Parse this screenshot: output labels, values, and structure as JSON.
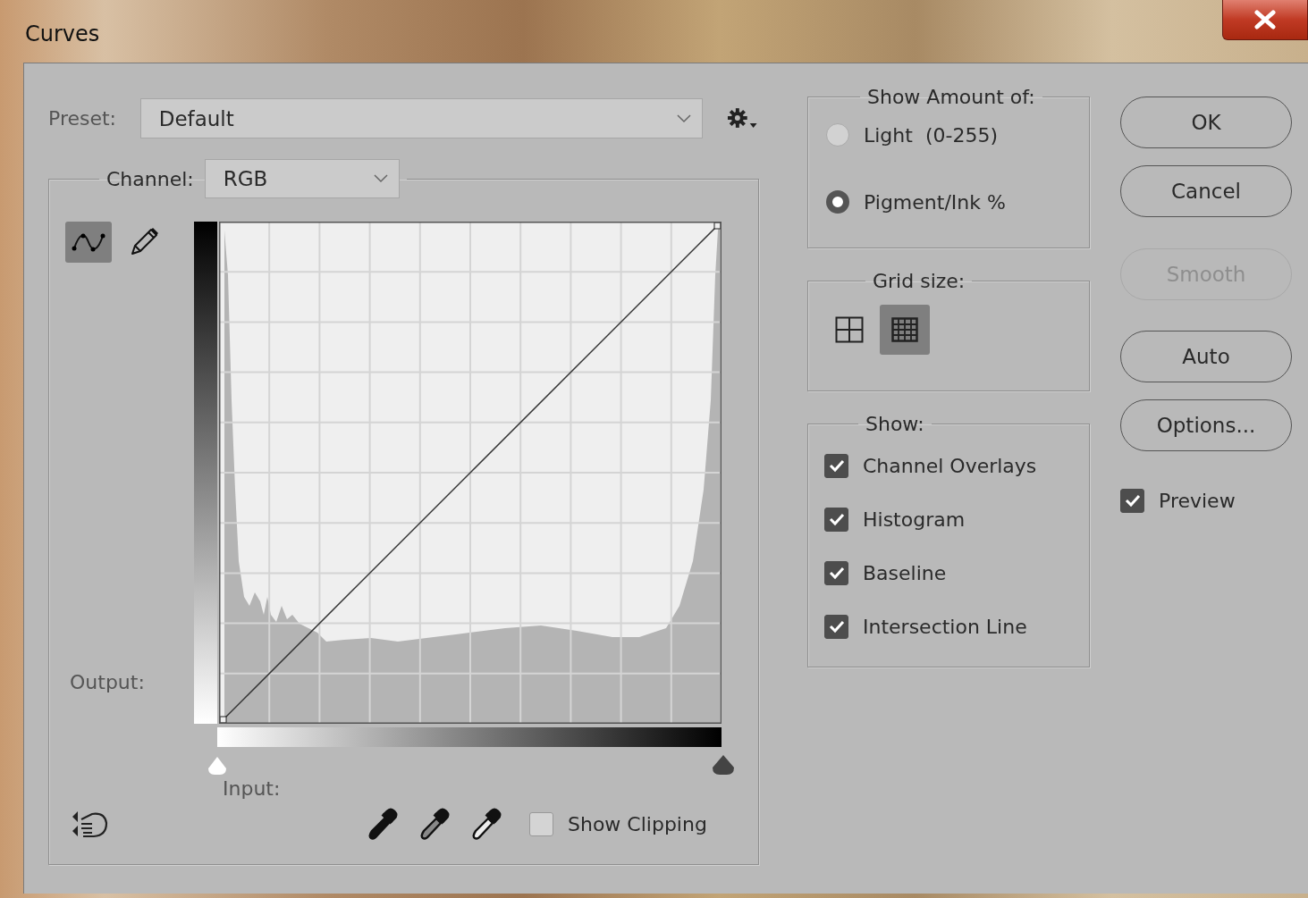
{
  "window": {
    "title": "Curves"
  },
  "preset": {
    "label": "Preset:",
    "value": "Default"
  },
  "channel": {
    "label": "Channel:",
    "value": "RGB"
  },
  "tools": [
    {
      "kind": "curve",
      "selected": true
    },
    {
      "kind": "pencil",
      "selected": false
    }
  ],
  "output_label": "Output:",
  "input_label": "Input:",
  "show_clipping": {
    "label": "Show Clipping",
    "checked": false
  },
  "show_amount": {
    "title": "Show Amount of:",
    "options": [
      {
        "label": "Light  (0-255)",
        "selected": false
      },
      {
        "label": "Pigment/Ink %",
        "selected": true
      }
    ]
  },
  "grid_size": {
    "title": "Grid size:",
    "options": [
      {
        "kind": "simple",
        "selected": false
      },
      {
        "kind": "detailed",
        "selected": true
      }
    ]
  },
  "show": {
    "title": "Show:",
    "options": [
      {
        "label": "Channel Overlays",
        "checked": true
      },
      {
        "label": "Histogram",
        "checked": true
      },
      {
        "label": "Baseline",
        "checked": true
      },
      {
        "label": "Intersection Line",
        "checked": true
      }
    ]
  },
  "buttons": [
    {
      "label": "OK",
      "disabled": false
    },
    {
      "label": "Cancel",
      "disabled": false
    },
    {
      "label": "Smooth",
      "disabled": true
    },
    {
      "label": "Auto",
      "disabled": false
    },
    {
      "label": "Options...",
      "disabled": false
    }
  ],
  "preview": {
    "label": "Preview",
    "checked": true
  }
}
